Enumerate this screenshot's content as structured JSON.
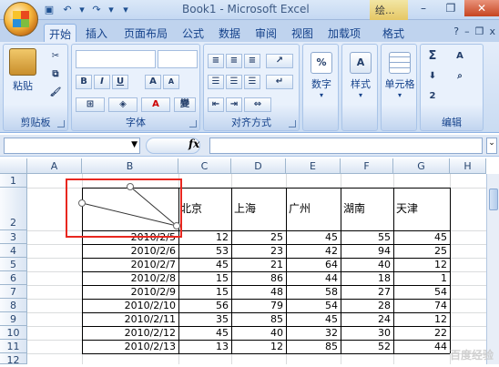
{
  "window": {
    "title": "Book1 - Microsoft Excel",
    "context_tab": "绘...",
    "min": "–",
    "restore": "❐",
    "close": "✕"
  },
  "qat": [
    "save-icon",
    "undo-icon",
    "redo-icon",
    "customize-icon"
  ],
  "qat_glyphs": {
    "save": "▣",
    "undo": "↶",
    "undo_dd": "▾",
    "redo": "↷",
    "redo_dd": "▾",
    "customize": "▾"
  },
  "tabs": [
    {
      "label": "开始",
      "active": true
    },
    {
      "label": "插入"
    },
    {
      "label": "页面布局"
    },
    {
      "label": "公式"
    },
    {
      "label": "数据"
    },
    {
      "label": "审阅"
    },
    {
      "label": "视图"
    },
    {
      "label": "加载项"
    },
    {
      "label": "格式"
    }
  ],
  "tab_right": {
    "help": "?",
    "min": "–",
    "restore": "❐",
    "close": "x"
  },
  "ribbon": {
    "clipboard": {
      "label": "剪贴板",
      "paste": "粘贴"
    },
    "font": {
      "label": "字体",
      "bold": "B",
      "italic": "I",
      "underline": "U",
      "grow": "A",
      "shrink": "A",
      "color": "A"
    },
    "alignment": {
      "label": "对齐方式"
    },
    "number": {
      "label": "数字",
      "button": "数字",
      "icon": "%"
    },
    "styles": {
      "button": "样式"
    },
    "cells": {
      "button": "单元格"
    },
    "editing": {
      "label": "编辑",
      "sum": "Σ",
      "sort": "A",
      "clear": "2"
    }
  },
  "formula_bar": {
    "name_value": "",
    "fx": "fx",
    "formula_value": ""
  },
  "columns": [
    "A",
    "B",
    "C",
    "D",
    "E",
    "F",
    "G",
    "H"
  ],
  "rows": [
    "1",
    "2",
    "3",
    "4",
    "5",
    "6",
    "7",
    "8",
    "9",
    "10",
    "11",
    "12"
  ],
  "table": {
    "headers": [
      "北京",
      "上海",
      "广州",
      "湖南",
      "天津"
    ],
    "data": [
      {
        "date": "2010/2/5",
        "values": [
          12,
          25,
          45,
          55,
          45
        ]
      },
      {
        "date": "2010/2/6",
        "values": [
          53,
          23,
          42,
          94,
          25
        ]
      },
      {
        "date": "2010/2/7",
        "values": [
          45,
          21,
          64,
          40,
          12
        ]
      },
      {
        "date": "2010/2/8",
        "values": [
          15,
          86,
          44,
          18,
          1
        ]
      },
      {
        "date": "2010/2/9",
        "values": [
          15,
          48,
          58,
          27,
          54
        ]
      },
      {
        "date": "2010/2/10",
        "values": [
          56,
          79,
          54,
          28,
          74
        ]
      },
      {
        "date": "2010/2/11",
        "values": [
          35,
          85,
          45,
          24,
          12
        ]
      },
      {
        "date": "2010/2/12",
        "values": [
          45,
          40,
          32,
          30,
          22
        ]
      },
      {
        "date": "2010/2/13",
        "values": [
          13,
          12,
          85,
          52,
          44
        ]
      }
    ]
  },
  "colors": {
    "selection": "#e8271f",
    "ribbon": "#c9dbf2",
    "accent": "#15428b"
  },
  "watermark": "百度经验"
}
